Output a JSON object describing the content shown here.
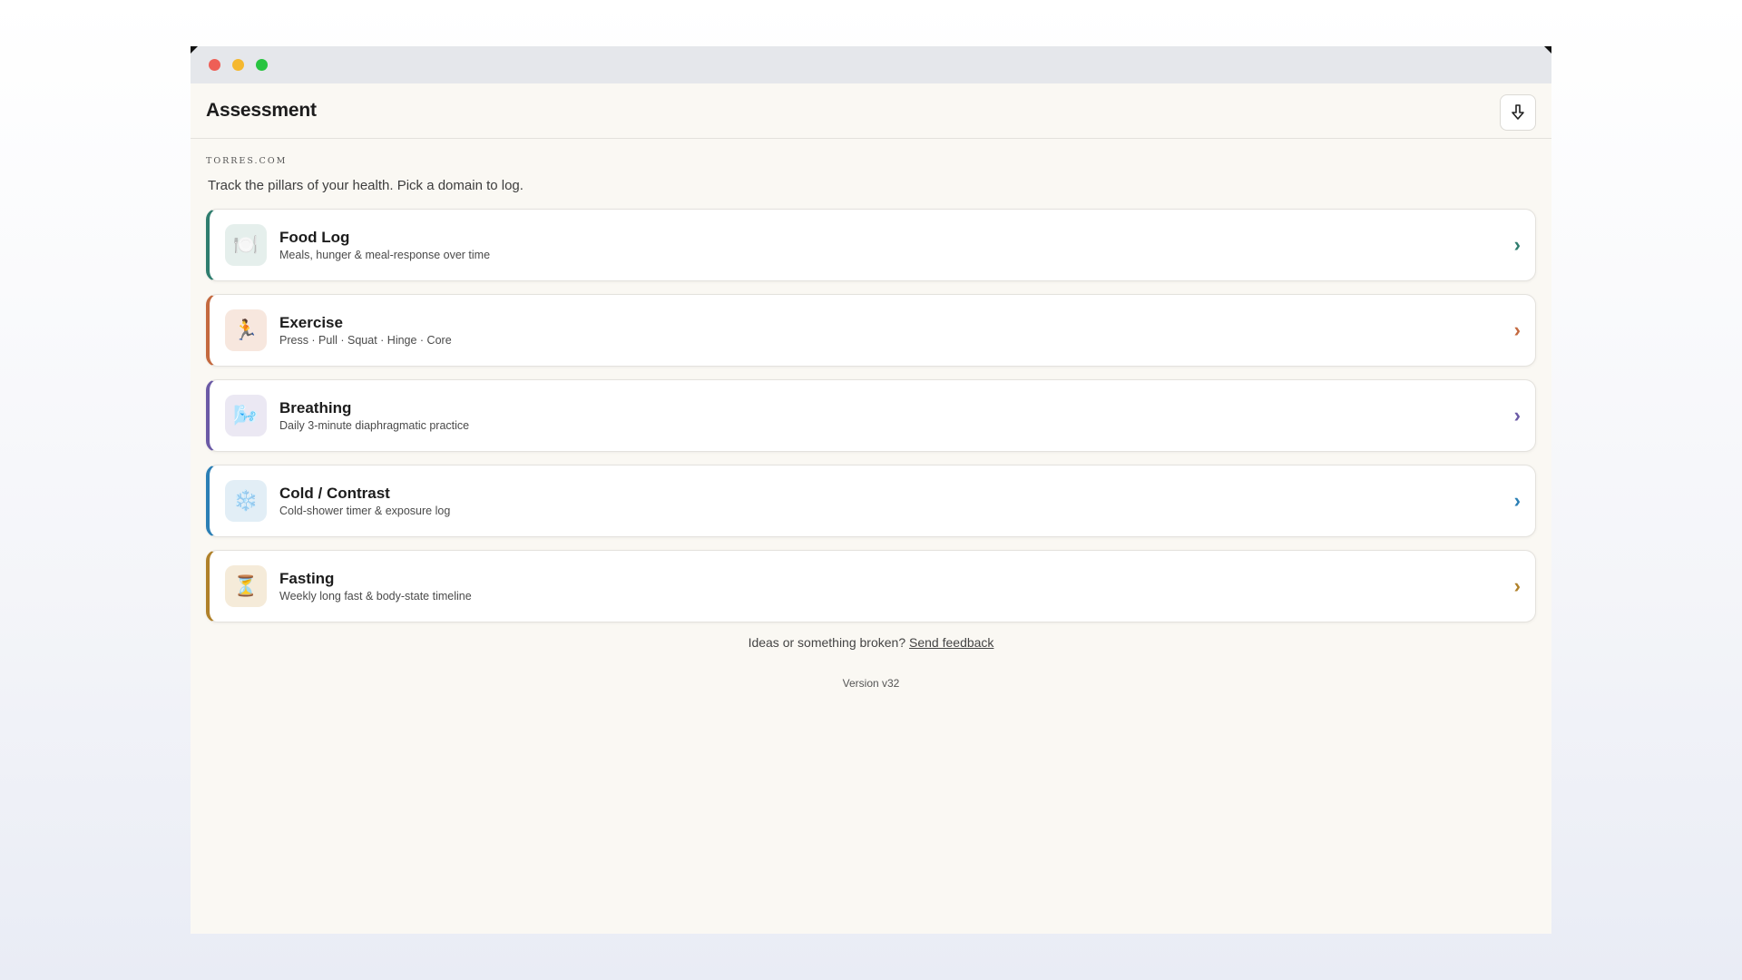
{
  "header": {
    "title": "Assessment"
  },
  "site": "TORRES.COM",
  "tagline": "Track the pillars of your health. Pick a domain to log.",
  "cards": [
    {
      "title": "Food Log",
      "subtitle": "Meals, hunger & meal-response over time",
      "icon": "plate-cutlery-icon",
      "glyph": "🍽️",
      "accent": "#2f7d6e",
      "icon_bg": "#e5efec"
    },
    {
      "title": "Exercise",
      "subtitle": "Press · Pull · Squat · Hinge · Core",
      "icon": "running-icon",
      "glyph": "🏃",
      "accent": "#c4693f",
      "icon_bg": "#f7e7de"
    },
    {
      "title": "Breathing",
      "subtitle": "Daily 3-minute diaphragmatic practice",
      "icon": "wind-icon",
      "glyph": "🌬️",
      "accent": "#6b5aa6",
      "icon_bg": "#ebe8f3"
    },
    {
      "title": "Cold / Contrast",
      "subtitle": "Cold-shower timer & exposure log",
      "icon": "snowflake-icon",
      "glyph": "❄️",
      "accent": "#2b7fb5",
      "icon_bg": "#e2eef6"
    },
    {
      "title": "Fasting",
      "subtitle": "Weekly long fast & body-state timeline",
      "icon": "hourglass-icon",
      "glyph": "⏳",
      "accent": "#b0812a",
      "icon_bg": "#f5ebd9"
    }
  ],
  "footer": {
    "feedback_text": "Ideas or something broken?",
    "feedback_link": "Send feedback",
    "version": "Version v32"
  },
  "colors": {
    "background": "#faf8f3",
    "titlebar": "#e5e7eb"
  }
}
